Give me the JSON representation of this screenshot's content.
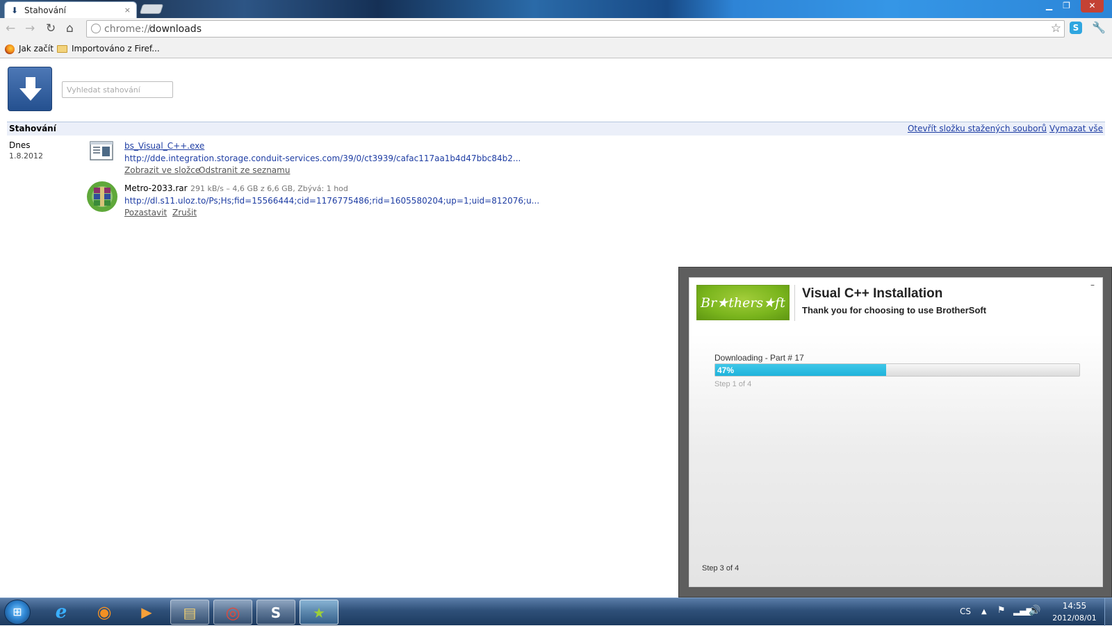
{
  "browser": {
    "tab": {
      "title": "Stahování",
      "close": "×"
    },
    "window_controls": {
      "minimize": "▁",
      "maximize": "❐",
      "close": "✕"
    },
    "nav": {
      "back": "←",
      "forward": "→",
      "reload": "↻",
      "home": "⌂"
    },
    "omnibox": {
      "scheme": "chrome://",
      "host": "downloads"
    },
    "star": "☆",
    "skype_ext": "S",
    "wrench": "🔧",
    "bookmarks": [
      {
        "label": "Jak začít",
        "icon": "firefox-icon"
      },
      {
        "label": "Importováno z Firef...",
        "icon": "folder-icon"
      }
    ]
  },
  "downloads_page": {
    "search_placeholder": "Vyhledat stahování",
    "header": {
      "title": "Stahování",
      "open_folder": "Otevřít složku stažených souborů",
      "clear_all": "Vymazat vše"
    },
    "date_group": {
      "day": "Dnes",
      "date": "1.8.2012"
    },
    "items": [
      {
        "name": "bs_Visual_C++.exe",
        "url": "http://dde.integration.storage.conduit-services.com/39/0/ct3939/cafac117aa1b4d47bbc84b2...",
        "actions": [
          "Zobrazit ve složce",
          "Odstranit ze seznamu"
        ],
        "icon": "exe-file-icon"
      },
      {
        "name": "Metro-2033.rar",
        "status": "291 kB/s – 4,6 GB z 6,6 GB, Zbývá: 1 hod",
        "url": "http://dl.s11.uloz.to/Ps;Hs;fid=15566444;cid=1176775486;rid=1605580204;up=1;uid=812076;u...",
        "actions": [
          "Pozastavit",
          "Zrušit"
        ],
        "icon": "winrar-icon"
      }
    ]
  },
  "installer": {
    "logo_text": "Br★thers★ft",
    "title": "Visual C++ Installation",
    "subtitle": "Thank you for choosing to use BrotherSoft",
    "minimize": "–",
    "part_label": "Downloading - Part # 17",
    "progress": 0.47,
    "progress_text": "47%",
    "step_small": "Step 1 of 4",
    "step_bottom": "Step 3 of 4",
    "accent": "#1fb3db"
  },
  "taskbar": {
    "start": "⊞",
    "apps": [
      {
        "name": "internet-explorer",
        "glyph": "e"
      },
      {
        "name": "firefox",
        "glyph": "◉"
      },
      {
        "name": "media-player",
        "glyph": "▶"
      },
      {
        "name": "explorer",
        "glyph": "▤"
      },
      {
        "name": "chrome",
        "glyph": "◎"
      },
      {
        "name": "skype",
        "glyph": "S"
      },
      {
        "name": "installer",
        "glyph": "★"
      }
    ],
    "tray": {
      "lang": "CS",
      "arrow": "▲",
      "flag": "⚑",
      "network": "▂▄▆",
      "volume": "🔊",
      "time": "14:55",
      "date": "2012/08/01"
    }
  }
}
